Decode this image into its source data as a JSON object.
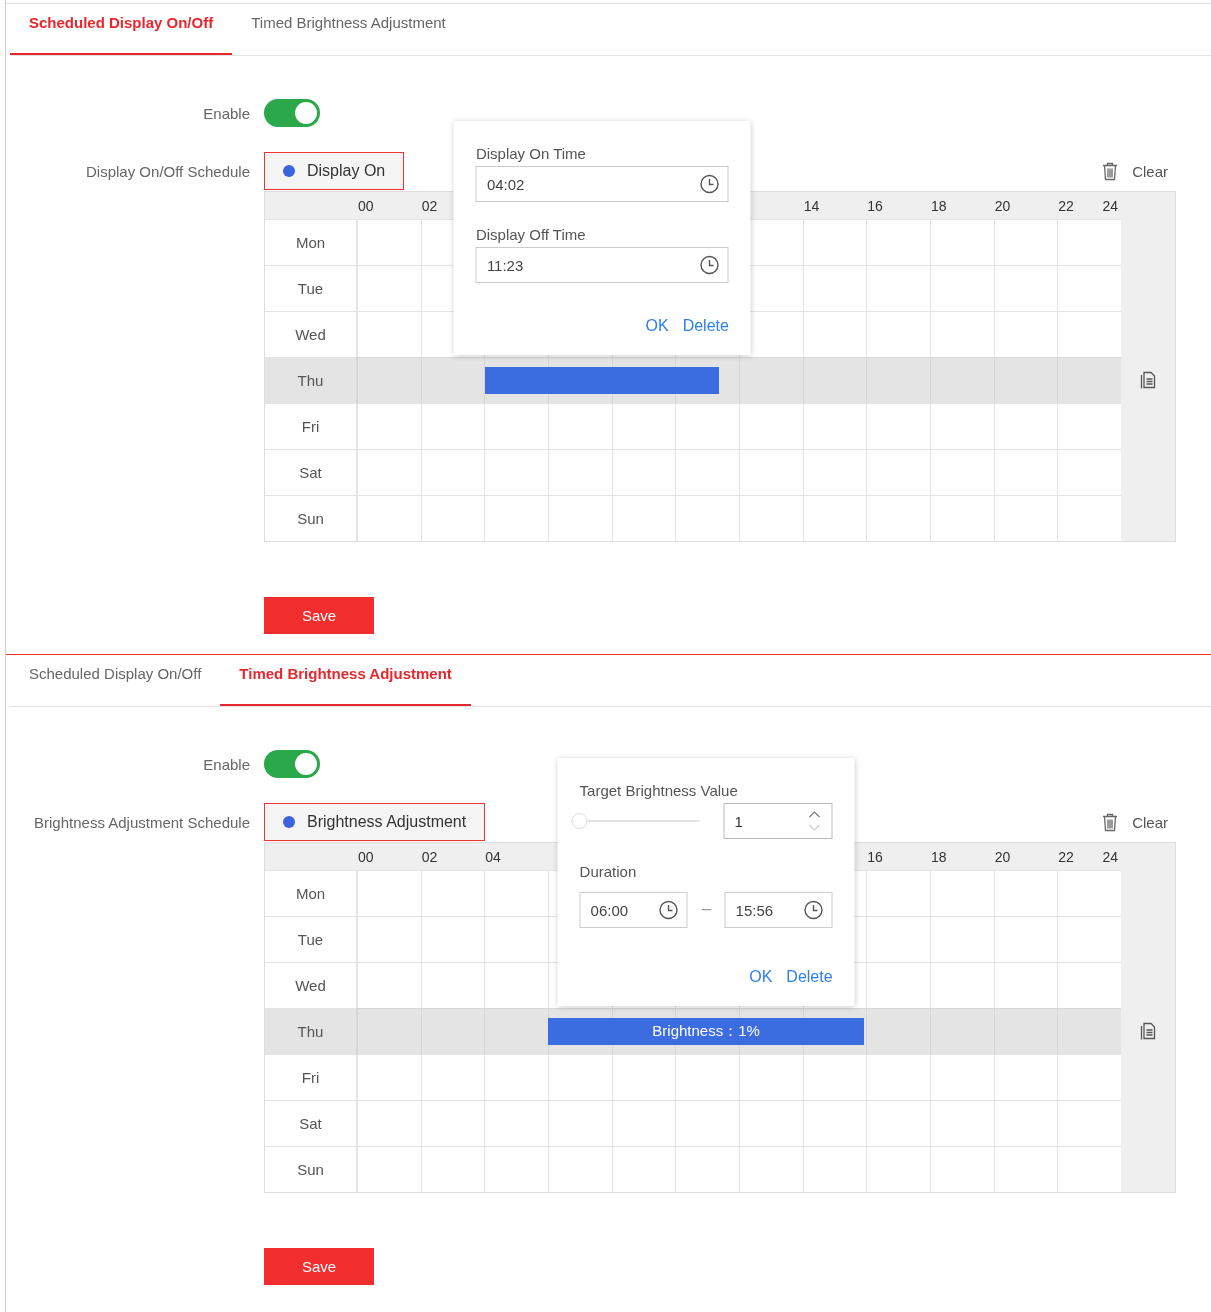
{
  "panels": [
    {
      "tabs": [
        {
          "label": "Scheduled Display On/Off",
          "selected": true
        },
        {
          "label": "Timed Brightness Adjustment",
          "selected": false
        }
      ],
      "enable": {
        "label": "Enable",
        "on": true
      },
      "schedule_label": "Display On/Off Schedule",
      "legend": {
        "label": "Display On",
        "color": "#3b63e0"
      },
      "clear": "Clear",
      "hours": [
        "00",
        "02",
        "14",
        "16",
        "18",
        "20",
        "22",
        "24"
      ],
      "days": [
        {
          "label": "Mon",
          "selected": false
        },
        {
          "label": "Tue",
          "selected": false
        },
        {
          "label": "Wed",
          "selected": false
        },
        {
          "label": "Thu",
          "selected": true,
          "segment": {
            "kind": "bar"
          }
        },
        {
          "label": "Fri",
          "selected": false
        },
        {
          "label": "Sat",
          "selected": false
        },
        {
          "label": "Sun",
          "selected": false
        }
      ],
      "popup": {
        "kind": "times",
        "fields": [
          {
            "label": "Display On Time",
            "value": "04:02"
          },
          {
            "label": "Display Off Time",
            "value": "11:23"
          }
        ],
        "actions": [
          "OK",
          "Delete"
        ]
      },
      "save": "Save"
    },
    {
      "tabs": [
        {
          "label": "Scheduled Display On/Off",
          "selected": false
        },
        {
          "label": "Timed Brightness Adjustment",
          "selected": true
        }
      ],
      "enable": {
        "label": "Enable",
        "on": true
      },
      "schedule_label": "Brightness Adjustment Schedule",
      "legend": {
        "label": "Brightness Adjustment",
        "color": "#3b63e0"
      },
      "clear": "Clear",
      "hours": [
        "00",
        "02",
        "04",
        "16",
        "18",
        "20",
        "22",
        "24"
      ],
      "days": [
        {
          "label": "Mon",
          "selected": false
        },
        {
          "label": "Tue",
          "selected": false
        },
        {
          "label": "Wed",
          "selected": false
        },
        {
          "label": "Thu",
          "selected": true,
          "segment": {
            "kind": "bar",
            "label": "Brightness：1%"
          }
        },
        {
          "label": "Fri",
          "selected": false
        },
        {
          "label": "Sat",
          "selected": false
        },
        {
          "label": "Sun",
          "selected": false
        }
      ],
      "popup": {
        "kind": "brightness",
        "title": "Target Brightness Value",
        "level": 0,
        "value": "1",
        "duration_label": "Duration",
        "from": "06:00",
        "to": "15:56",
        "actions": [
          "OK",
          "Delete"
        ]
      },
      "save": "Save"
    }
  ]
}
